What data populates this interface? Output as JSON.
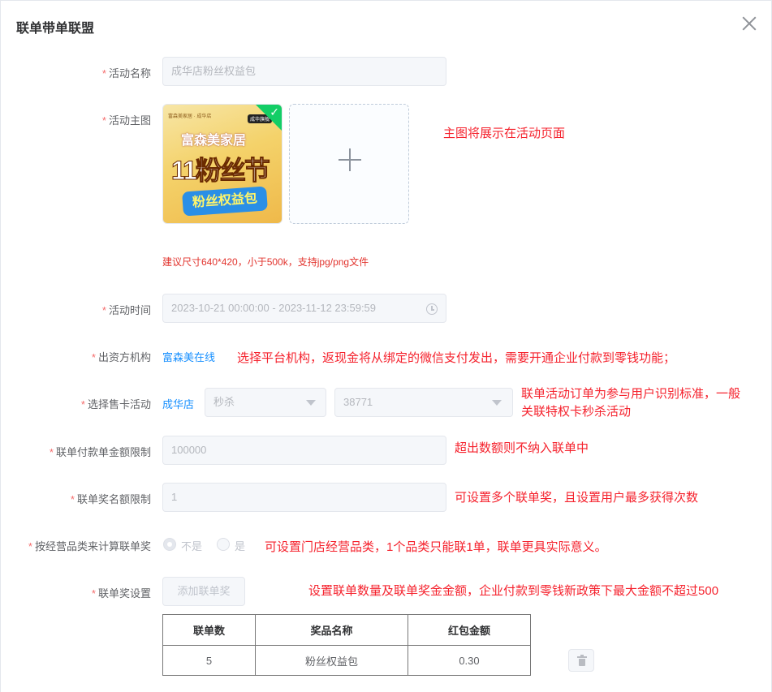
{
  "dialog": {
    "title": "联单带单联盟"
  },
  "form": {
    "activity_name": {
      "label": "活动名称",
      "value": "成华店粉丝权益包"
    },
    "main_image": {
      "label": "活动主图",
      "hint": "建议尺寸640*420，小于500k，支持jpg/png文件",
      "image_text": {
        "brand": "富森美家居",
        "big": "11粉丝节",
        "pack": "粉丝权益包",
        "tag": "成华旗舰",
        "tiny": "富森美家居 · 成华店"
      }
    },
    "activity_time": {
      "label": "活动时间",
      "value": "2023-10-21 00:00:00 - 2023-11-12 23:59:59"
    },
    "funder": {
      "label": "出资方机构",
      "value": "富森美在线"
    },
    "card_activity": {
      "label": "选择售卡活动",
      "store": "成华店",
      "type": "秒杀",
      "id": "38771"
    },
    "pay_limit": {
      "label": "联单付款单金额限制",
      "value": "100000"
    },
    "quota_limit": {
      "label": "联单奖名额限制",
      "value": "1"
    },
    "category_calc": {
      "label": "按经营品类来计算联单奖",
      "options": [
        "不是",
        "是"
      ],
      "selected": "不是"
    },
    "prize_setting": {
      "label": "联单奖设置",
      "add_button": "添加联单奖"
    }
  },
  "prize_table": {
    "headers": [
      "联单数",
      "奖品名称",
      "红包金额"
    ],
    "rows": [
      [
        "5",
        "粉丝权益包",
        "0.30"
      ]
    ]
  },
  "annotations": {
    "main_image": "主图将展示在活动页面",
    "funder": "选择平台机构，返现金将从绑定的微信支付发出，需要开通企业付款到零钱功能；",
    "card_activity_line1": "联单活动订单为参与用户识别标准，一般",
    "card_activity_line2": "关联特权卡秒杀活动",
    "pay_limit": "超出数额则不纳入联单中",
    "quota_limit": "可设置多个联单奖，且设置用户最多获得次数",
    "category_calc": "可设置门店经营品类，1个品类只能联1单，联单更具实际意义。",
    "prize_setting": "设置联单数量及联单奖金金额，企业付款到零钱新政策下最大金额不超过500"
  },
  "colors": {
    "required_star": "#f56c6c",
    "annotation": "#f5222d",
    "link": "#1890ff",
    "check_badge": "#13ce66"
  }
}
